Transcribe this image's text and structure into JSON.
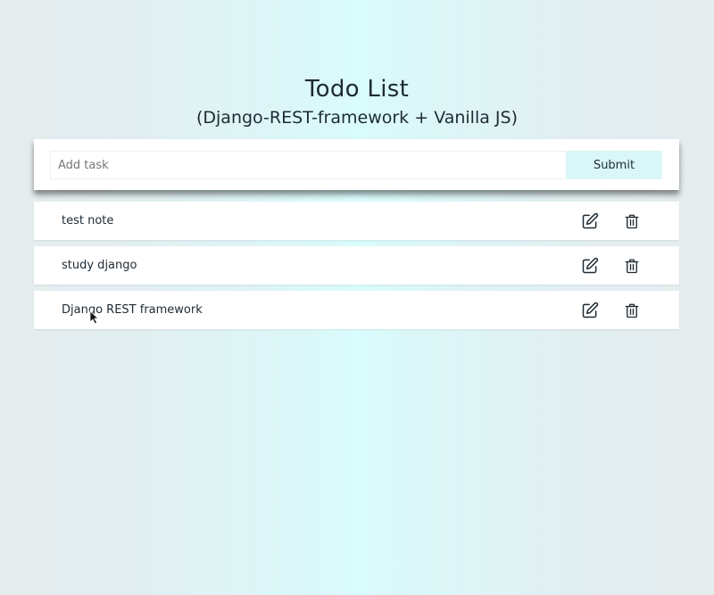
{
  "header": {
    "title": "Todo List",
    "subtitle": "(Django-REST-framework + Vanilla JS)"
  },
  "form": {
    "input_placeholder": "Add task",
    "input_value": "",
    "submit_label": "Submit"
  },
  "tasks": [
    {
      "title": "test note",
      "edit_icon": "edit-icon",
      "delete_icon": "trash-icon"
    },
    {
      "title": "study django",
      "edit_icon": "edit-icon",
      "delete_icon": "trash-icon"
    },
    {
      "title": "Django REST framework",
      "edit_icon": "edit-icon",
      "delete_icon": "trash-icon"
    }
  ],
  "colors": {
    "accent": "#d9f7f7",
    "card": "#ffffff",
    "text": "#1e2a33"
  }
}
